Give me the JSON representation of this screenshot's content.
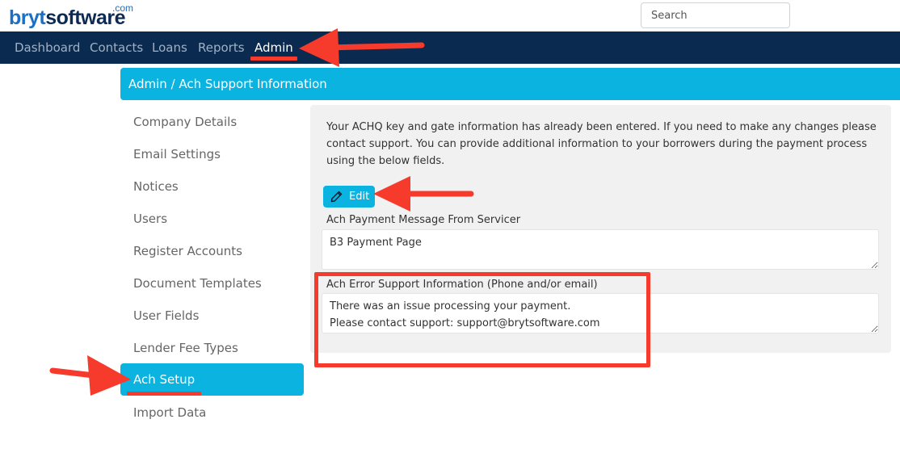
{
  "logo": {
    "bryt": "bryt",
    "software": "software",
    "com": ".com"
  },
  "search": {
    "placeholder": "Search"
  },
  "nav": {
    "items": [
      {
        "label": "Dashboard"
      },
      {
        "label": "Contacts"
      },
      {
        "label": "Loans"
      },
      {
        "label": "Reports"
      },
      {
        "label": "Admin",
        "active": true
      }
    ]
  },
  "breadcrumb": {
    "text": "Admin / Ach Support Information"
  },
  "sidebar": {
    "items": [
      {
        "label": "Company Details"
      },
      {
        "label": "Email Settings"
      },
      {
        "label": "Notices"
      },
      {
        "label": "Users"
      },
      {
        "label": "Register Accounts"
      },
      {
        "label": "Document Templates"
      },
      {
        "label": "User Fields"
      },
      {
        "label": "Lender Fee Types"
      },
      {
        "label": "Ach Setup",
        "active": true
      },
      {
        "label": "Import Data"
      }
    ]
  },
  "content": {
    "info_text": "Your ACHQ key and gate information has already been entered. If you need to make any changes please contact support. You can provide additional information to your borrowers during the payment process using the below fields.",
    "edit_label": "Edit",
    "payment_message": {
      "label": "Ach Payment Message From Servicer",
      "value": "B3 Payment Page"
    },
    "error_support": {
      "label": "Ach Error Support Information (Phone and/or email)",
      "value": "There was an issue processing your payment.\nPlease contact support: support@brytsoftware.com"
    }
  },
  "colors": {
    "navbar": "#0b2a4f",
    "accent": "#0ab3e0",
    "annotation": "#f63a2b"
  },
  "icons": {
    "edit": "pencil-icon",
    "annotation_arrows": "arrow-icon"
  }
}
